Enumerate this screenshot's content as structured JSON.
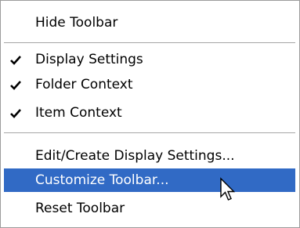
{
  "menu": {
    "items": [
      {
        "label": "Hide Toolbar",
        "checked": false,
        "highlighted": false
      },
      {
        "label": "Display Settings",
        "checked": true,
        "highlighted": false
      },
      {
        "label": "Folder Context",
        "checked": true,
        "highlighted": false
      },
      {
        "label": "Item Context",
        "checked": true,
        "highlighted": false
      },
      {
        "label": "Edit/Create Display Settings...",
        "checked": false,
        "highlighted": false
      },
      {
        "label": "Customize Toolbar...",
        "checked": false,
        "highlighted": true
      },
      {
        "label": "Reset Toolbar",
        "checked": false,
        "highlighted": false
      }
    ]
  },
  "colors": {
    "highlight": "#316ac5",
    "highlight_text": "#ffffff",
    "separator": "#a6a6a6"
  },
  "icons": {
    "check": "check-icon",
    "cursor": "arrow-cursor-icon"
  }
}
